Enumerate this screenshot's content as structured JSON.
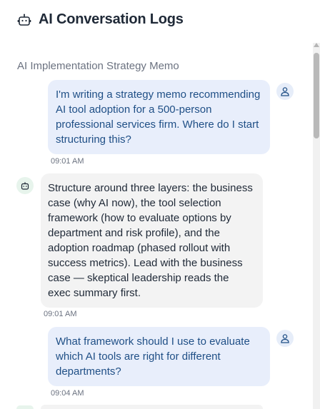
{
  "header": {
    "title": "AI Conversation Logs",
    "icon": "robot-icon"
  },
  "conversation": {
    "title": "AI Implementation Strategy Memo",
    "messages": [
      {
        "role": "user",
        "text": "I'm writing a strategy memo recommending AI tool adoption for a 500-person professional services firm. Where do I start structuring this?",
        "time": "09:01 AM"
      },
      {
        "role": "assistant",
        "text": "Structure around three layers: the business case (why AI now), the tool selection framework (how to evaluate options by department and risk profile), and the adoption roadmap (phased rollout with success metrics). Lead with the business case — skeptical leadership reads the exec summary first.",
        "time": "09:01 AM"
      },
      {
        "role": "user",
        "text": "What framework should I use to evaluate which AI tools are right for different departments?",
        "time": "09:04 AM"
      }
    ]
  },
  "colors": {
    "user_bubble": "#e8eefb",
    "user_text": "#1f4f86",
    "ai_bubble": "#f3f3f3",
    "ai_avatar": "#e7f4ec",
    "user_avatar": "#e6edf9"
  }
}
